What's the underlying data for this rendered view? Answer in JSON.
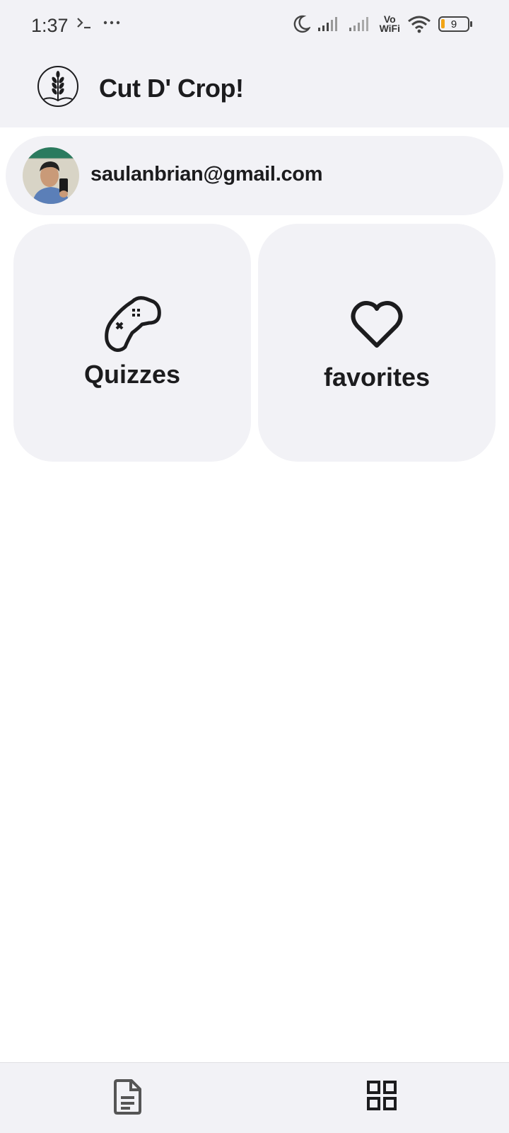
{
  "status_bar": {
    "time": "1:37",
    "vowifi_top": "Vo",
    "vowifi_bottom": "WiFi",
    "battery_level": "9",
    "icons": [
      "terminal-icon",
      "more-dots-icon",
      "moon-icon",
      "signal-icon",
      "signal-icon",
      "vowifi-icon",
      "wifi-icon",
      "battery-icon"
    ]
  },
  "header": {
    "title": "Cut D' Crop!",
    "logo_icon": "wheat-logo-icon"
  },
  "profile": {
    "email": "saulanbrian@gmail.com"
  },
  "tiles": [
    {
      "label": "Quizzes",
      "icon": "gamepad-icon"
    },
    {
      "label": "favorites",
      "icon": "heart-icon"
    }
  ],
  "bottom_nav": [
    {
      "icon": "document-icon"
    },
    {
      "icon": "grid-icon"
    }
  ],
  "colors": {
    "surface": "#f2f2f6",
    "text": "#1c1c1e",
    "background": "#ffffff",
    "battery_accent": "#f2a516"
  }
}
